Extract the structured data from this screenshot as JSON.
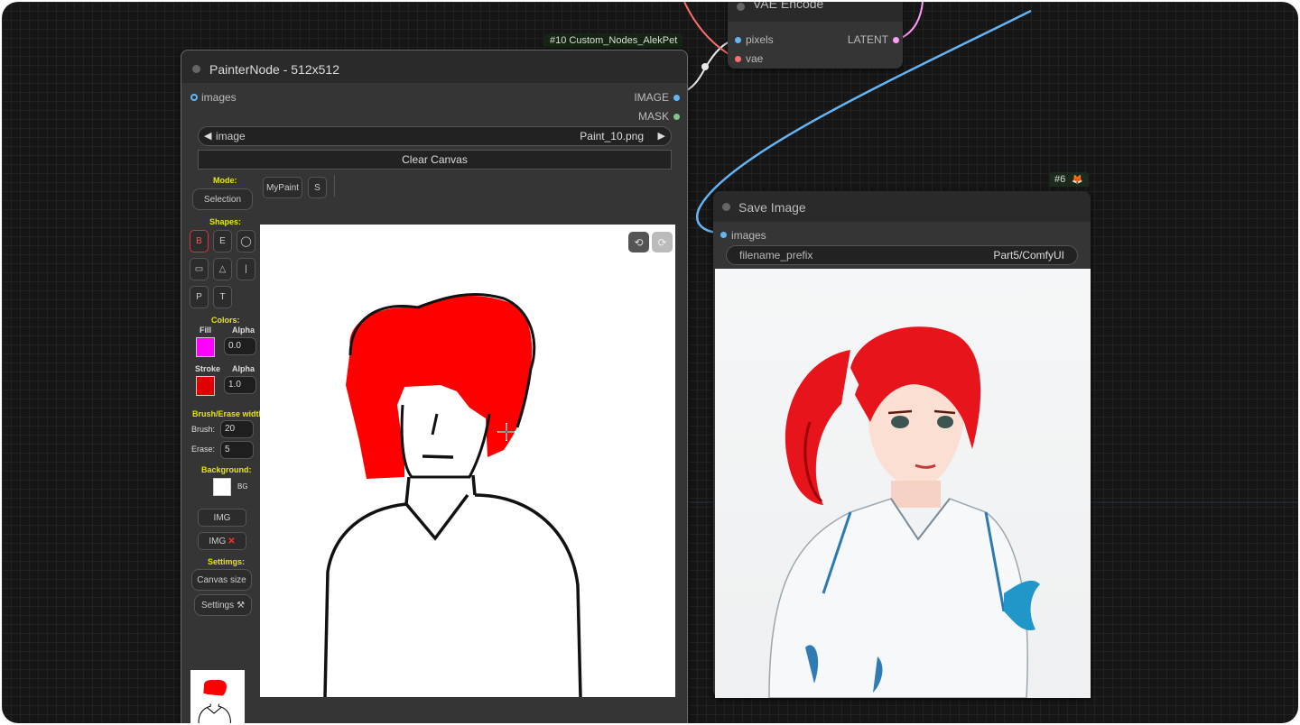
{
  "vae_node": {
    "title": "VAE Encode",
    "inputs": [
      "pixels",
      "vae"
    ],
    "output": "LATENT"
  },
  "painter_node": {
    "badge": "#10 Custom_Nodes_AlekPet",
    "title": "PainterNode - 512x512",
    "input": "images",
    "outputs": [
      "IMAGE",
      "MASK"
    ],
    "image_widget": {
      "label": "image",
      "value": "Paint_10.png"
    },
    "clear_button": "Clear Canvas",
    "mode_label": "Mode:",
    "selection_button": "Selection",
    "mypaint_button": "MyPaint",
    "s_button": "S",
    "shapes_label": "Shapes:",
    "shape_buttons": [
      "B",
      "E",
      "◯",
      "▭",
      "△",
      "|",
      "P",
      "T"
    ],
    "colors_label": "Colors:",
    "fill_label": "Fill",
    "alpha_label": "Alpha",
    "fill_color": "#ff00ff",
    "fill_alpha": "0.0",
    "stroke_label": "Stroke",
    "stroke_color": "#e00000",
    "stroke_alpha": "1.0",
    "brush_label": "Brush/Erase width:",
    "brush_field_label": "Brush:",
    "brush_value": "20",
    "erase_field_label": "Erase:",
    "erase_value": "5",
    "background_label": "Background:",
    "bg_label": "BG",
    "img_button": "IMG",
    "img_remove_button": "IMG",
    "img_remove_glyph": "✕",
    "settings_label": "Settimgs:",
    "canvas_size_button": "Canvas size",
    "settings_button": "Settings",
    "settings_glyph": "⚒",
    "undo_glyph": "⟲",
    "redo_glyph": "⟳"
  },
  "save_node": {
    "badge": "#6",
    "badge_glyph": "🦊",
    "title": "Save Image",
    "input": "images",
    "filename_label": "filename_prefix",
    "filename_value": "Part5/ComfyUI"
  },
  "colors": {
    "image_link": "#64b5f6",
    "vae_link": "#ff6e6e",
    "latent_link": "#ff9cf9",
    "hair_red": "#ff0000",
    "mask_green": "#81c784"
  }
}
